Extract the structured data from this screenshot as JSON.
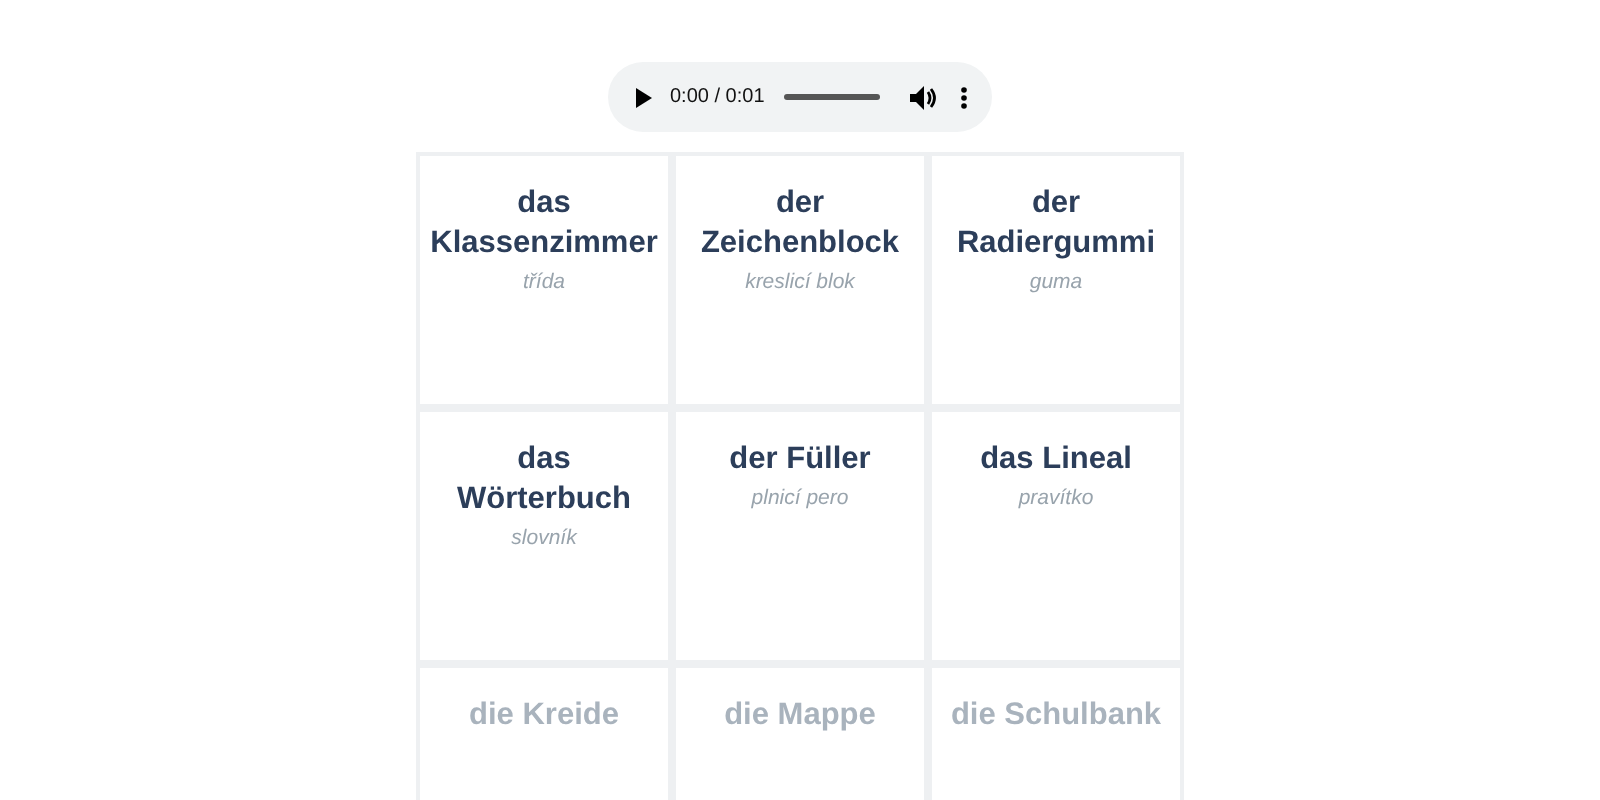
{
  "audio_player": {
    "time": "0:00 / 0:01"
  },
  "cards": [
    {
      "article": "das",
      "word": "Klassenzimmer",
      "translation": "třída"
    },
    {
      "article": "der",
      "word": "Zeichenblock",
      "translation": "kreslicí blok"
    },
    {
      "article": "der",
      "word": "Radiergummi",
      "translation": "guma"
    },
    {
      "article": "das",
      "word": "Wörterbuch",
      "translation": "slovník"
    },
    {
      "article": "der",
      "word": "Füller",
      "translation": "plnicí pero"
    },
    {
      "article": "das",
      "word": "Lineal",
      "translation": "pravítko"
    }
  ],
  "faded_cards": [
    {
      "article": "die",
      "word": "Kreide"
    },
    {
      "article": "die",
      "word": "Mappe"
    },
    {
      "article": "die",
      "word": "Schulbank"
    }
  ]
}
